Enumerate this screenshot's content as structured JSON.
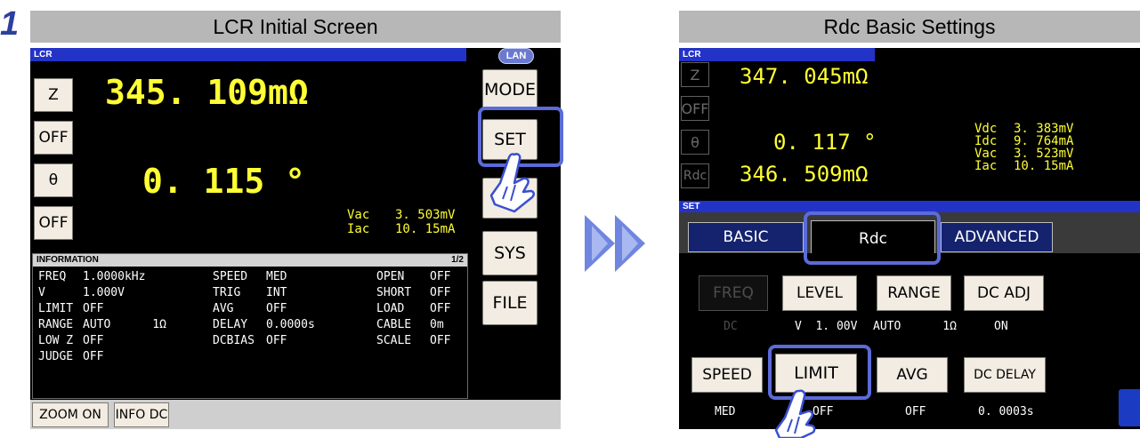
{
  "step": "1",
  "left": {
    "title": "LCR Initial Screen",
    "mode_strip": "LCR",
    "lan": "LAN",
    "param_buttons": [
      "Z",
      "OFF",
      "θ",
      "OFF"
    ],
    "primary_value": "345. 109mΩ",
    "secondary_value": "0. 115  °",
    "vac_label": "Vac",
    "vac_value": "3. 503mV",
    "iac_label": "Iac",
    "iac_value": "10. 15mA",
    "side_buttons": [
      "MODE",
      "SET",
      "ADJ",
      "SYS",
      "FILE"
    ],
    "info": {
      "header": "INFORMATION",
      "page": "1/2",
      "rows": [
        [
          "FREQ",
          "1.0000kHz",
          "SPEED",
          "MED",
          "OPEN",
          "OFF"
        ],
        [
          "V",
          "1.000V",
          "TRIG",
          "INT",
          "SHORT",
          "OFF"
        ],
        [
          "LIMIT",
          "OFF",
          "AVG",
          "OFF",
          "LOAD",
          "OFF"
        ],
        [
          "RANGE",
          "AUTO      1Ω",
          "DELAY",
          "0.0000s",
          "CABLE",
          "0m"
        ],
        [
          "LOW Z",
          "OFF",
          "DCBIAS",
          "OFF",
          "SCALE",
          "OFF"
        ],
        [
          "JUDGE",
          "OFF",
          "",
          "",
          "",
          ""
        ]
      ]
    },
    "bottom_buttons": [
      "ZOOM ON",
      "INFO DC"
    ]
  },
  "right": {
    "title": "Rdc Basic Settings",
    "mode_strip": "LCR",
    "param_buttons": [
      "Z",
      "OFF",
      "θ",
      "Rdc"
    ],
    "value1": "347. 045mΩ",
    "value2": "0. 117  °",
    "value3": "346. 509mΩ",
    "side_readings": [
      {
        "label": "Vdc",
        "value": "3. 383mV"
      },
      {
        "label": "Idc",
        "value": "9. 764mA"
      },
      {
        "label": "Vac",
        "value": "3. 523mV"
      },
      {
        "label": "Iac",
        "value": "10. 15mA"
      }
    ],
    "set_strip": "SET",
    "tabs": [
      "BASIC",
      "Rdc",
      "ADVANCED"
    ],
    "row1_buttons": [
      "FREQ",
      "LEVEL",
      "RANGE",
      "DC ADJ"
    ],
    "row1_values": [
      "DC",
      "V  1. 00V",
      "AUTO      1Ω",
      "ON"
    ],
    "row2_buttons": [
      "SPEED",
      "LIMIT",
      "AVG",
      "DC DELAY"
    ],
    "row2_values": [
      "MED",
      "OFF",
      "OFF",
      "0. 0003s"
    ]
  },
  "colors": {
    "highlight": "#5b6bd8",
    "measurement_yellow": "#ffff33",
    "strip_blue": "#2333c8",
    "arrow_blue": "#6f86e0"
  }
}
